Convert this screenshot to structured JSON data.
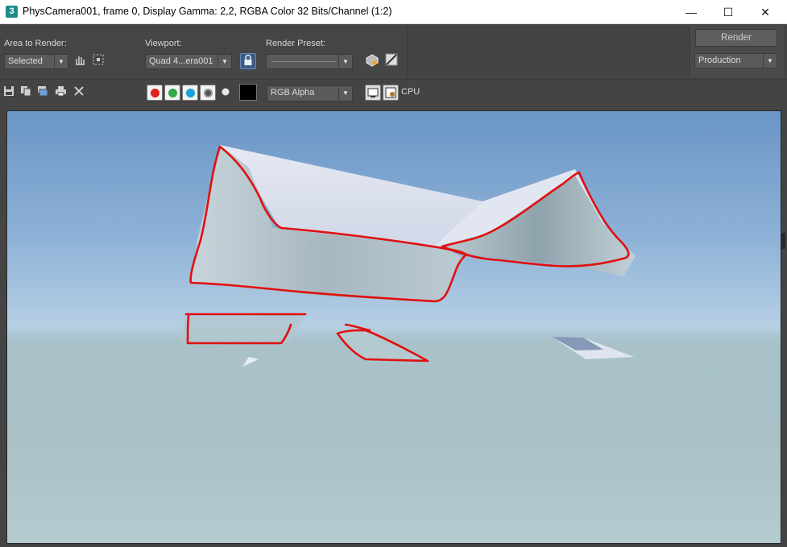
{
  "window": {
    "app_icon_glyph": "3",
    "title": "PhysCamera001, frame 0, Display Gamma: 2,2, RGBA Color 32 Bits/Channel (1:2)",
    "minimize_glyph": "—",
    "maximize_glyph": "☐",
    "close_glyph": "✕"
  },
  "controls": {
    "area_label": "Area to Render:",
    "area_value": "Selected",
    "viewport_label": "Viewport:",
    "viewport_value": "Quad 4...era001",
    "preset_label": "Render Preset:",
    "preset_value": "",
    "render_button": "Render",
    "production_value": "Production",
    "dropdown_arrow": "▼"
  },
  "toolbar": {
    "channel_value": "RGB Alpha",
    "cpu_label": "CPU"
  },
  "colors": {
    "red_channel": "#e02020",
    "green_channel": "#2eaa46",
    "blue_channel": "#1aa3d9",
    "annotation_stroke": "#e01010"
  },
  "icons": [
    "save-icon",
    "copy-icon",
    "clone-icon",
    "print-icon",
    "clear-icon",
    "lock-icon",
    "render-setup-icon",
    "environment-icon"
  ]
}
